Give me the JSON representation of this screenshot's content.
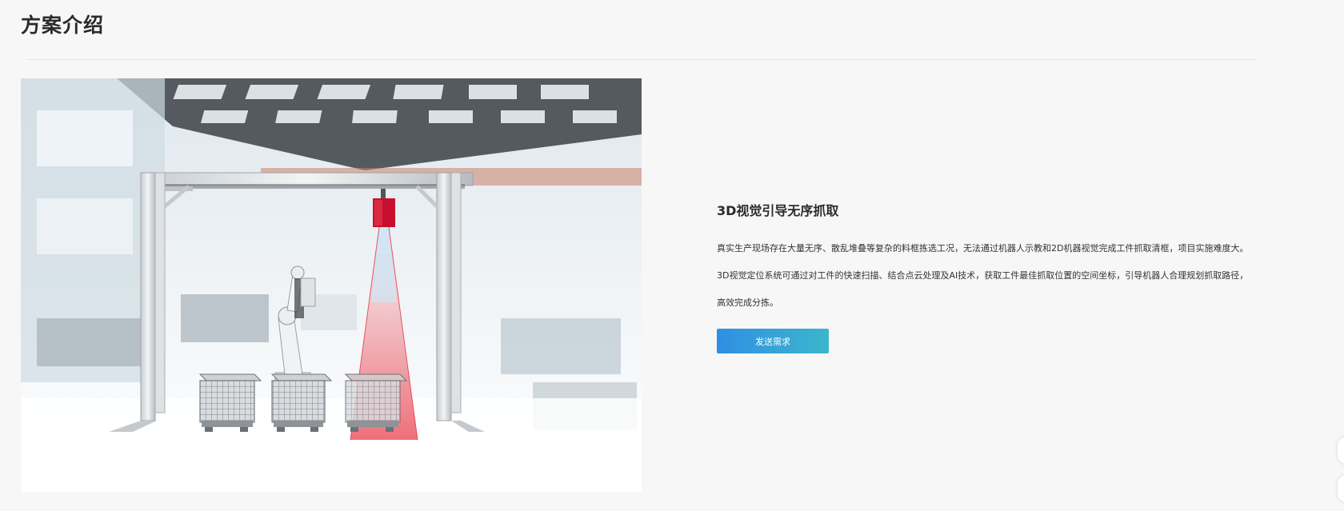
{
  "section": {
    "title": "方案介绍"
  },
  "solution": {
    "heading": "3D视觉引导无序抓取",
    "paragraphs": [
      "真实生产现场存在大量无序、散乱堆叠等复杂的料框拣选工况，无法通过机器人示教和2D机器视觉完成工件抓取清框，项目实施难度大。",
      "3D视觉定位系统可通过对工件的快速扫描、结合点云处理及AI技术，获取工件最佳抓取位置的空间坐标，引导机器人合理规划抓取路径，",
      "高效完成分拣。"
    ],
    "cta_label": "发送需求"
  },
  "colors": {
    "background": "#f7f7f7",
    "button_gradient_start": "#2f8fe3",
    "button_gradient_end": "#3cb6cc",
    "camera_red": "#c8102e"
  }
}
